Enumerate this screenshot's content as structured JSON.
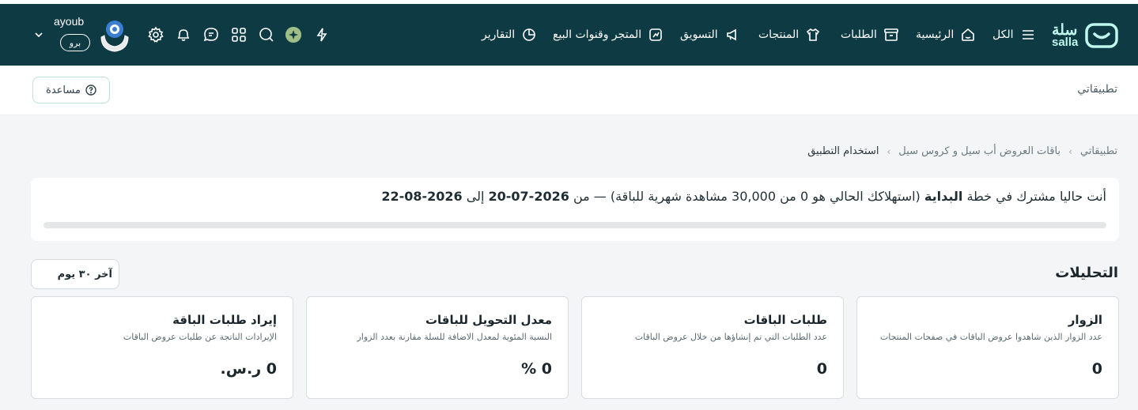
{
  "navbar": {
    "logo_top": "سلة",
    "logo_bottom": "salla",
    "items": [
      {
        "label": "الكل",
        "icon": "menu-icon"
      },
      {
        "label": "الرئيسية",
        "icon": "home-icon"
      },
      {
        "label": "الطلبات",
        "icon": "archive-icon"
      },
      {
        "label": "المنتجات",
        "icon": "shirt-icon"
      },
      {
        "label": "التسويق",
        "icon": "megaphone-icon"
      },
      {
        "label": "المتجر وقنوات البيع",
        "icon": "store-icon"
      },
      {
        "label": "التقارير",
        "icon": "pie-chart-icon"
      }
    ],
    "tools": [
      "bolt-icon",
      "ai-sparkle-icon",
      "search-icon",
      "apps-grid-icon",
      "chat-icon",
      "bell-icon",
      "gear-icon"
    ],
    "user": {
      "name": "ayoub",
      "plan_badge": "برو"
    }
  },
  "subheader": {
    "title": "تطبيقاتي",
    "help_label": "مساعدة"
  },
  "breadcrumb": [
    "تطبيقاتي",
    "باقات العروض أب سيل و كروس سيل",
    "استخدام التطبيق"
  ],
  "plan": {
    "prefix": "أنت حاليا مشترك في خطة",
    "plan_name": "البداية",
    "usage": "(استهلاكك الحالي هو 0 من 30,000 مشاهدة شهرية للباقة) — من",
    "start_date": "2026-07-20",
    "to": "إلى",
    "end_date": "2026-08-22",
    "progress_fraction": 0
  },
  "analytics": {
    "title": "التحليلات",
    "range": "آخر ٣٠ يوم",
    "cards": [
      {
        "title": "الزوار",
        "desc": "عدد الزوار الذين شاهدوا عروض الباقات في صفحات المنتجات",
        "value": "0"
      },
      {
        "title": "طلبات الباقات",
        "desc": "عدد الطلبات التي تم إنشاؤها من خلال عروض الباقات",
        "value": "0"
      },
      {
        "title": "معدل التحويل للباقات",
        "desc": "النسبة المئوية لمعدل الاضافة للسلة مقارنة بعدد الزوار",
        "value": "0 %"
      },
      {
        "title": "إيراد طلبات الباقة",
        "desc": "الإيرادات الناتجة عن طلبات عروض الباقات",
        "value": "0 ر.س."
      }
    ]
  },
  "colors": {
    "navbar": "#0e3a44",
    "accent": "#bff6ee",
    "background": "#f4f5f6"
  }
}
